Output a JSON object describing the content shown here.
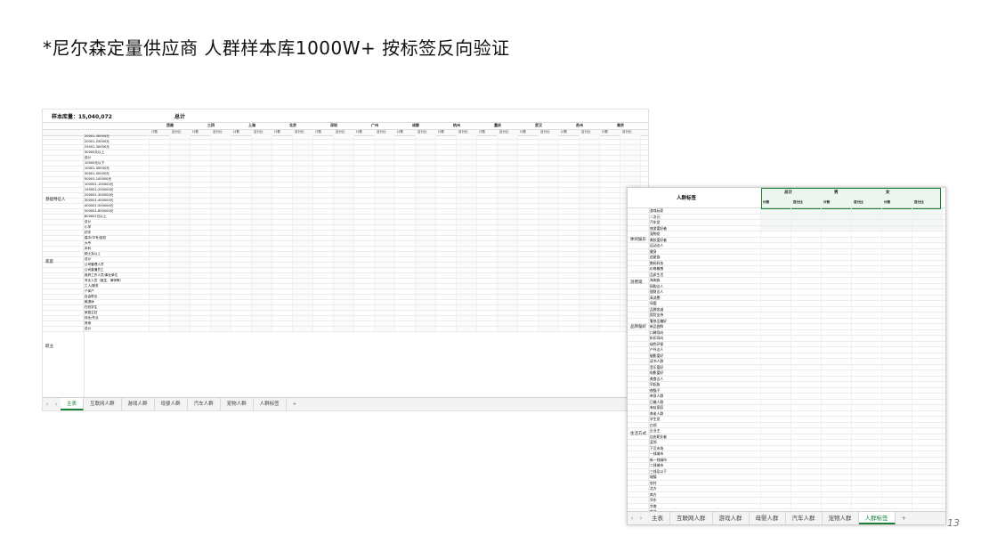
{
  "title": "*尼尔森定量供应商 人群样本库1000W+ 按标签反向验证",
  "page_number": "13",
  "sheet_left": {
    "sample_label": "样本库量：15,040,072",
    "total_label": "总计",
    "cities": [
      "西南",
      "三四",
      "上海",
      "北京",
      "深圳",
      "广州",
      "成都",
      "杭州",
      "重庆",
      "武汉",
      "苏州",
      "南京"
    ],
    "sub_headers": [
      "计数",
      "百分比"
    ],
    "categories": [
      "基础特征人",
      "家庭",
      "职业"
    ],
    "rows": [
      "20001-30000元",
      "20001-25000元",
      "25001-30000元",
      "30000元以上",
      "总计",
      "10000元以下",
      "10001-30000元",
      "30001-50000元",
      "50001-100000元",
      "100001-150000元",
      "150001-200000元",
      "200001-300000元",
      "300001-400000元",
      "400001-500000元",
      "500001-800000元",
      "800001元以上",
      "总计",
      "小学",
      "初中",
      "高中/中专/技校",
      "大专",
      "本科",
      "硕士及以上",
      "总计",
      "公司管理人员",
      "公司普通员工",
      "政府工作人员/事业单位",
      "专业人员（医生、律师等）",
      "工人/服务",
      "个体户",
      "自由职业",
      "离退休",
      "在校学生",
      "家庭主妇",
      "待业/失业",
      "其他",
      "总计"
    ],
    "tabs": [
      "主表",
      "互联网人群",
      "游戏人群",
      "母婴人群",
      "汽车人群",
      "宠物人群",
      "人群标签"
    ],
    "active_tab": "主表",
    "plus": "+"
  },
  "sheet_right": {
    "header_label": "人群标签",
    "col_groups": [
      "总计",
      "男",
      "女"
    ],
    "sub_headers": [
      "计数",
      "百分比",
      "计数",
      "百分比",
      "计数",
      "百分比"
    ],
    "categories": [
      "休闲娱乐",
      "消费观",
      "品牌偏好",
      "生活方式"
    ],
    "rows": [
      "游戏玩家",
      "二次元",
      "汽车党",
      "旅游爱好者",
      "宠物党",
      "美妆爱好者",
      "运动达人",
      "健身",
      "追星族",
      "数码科技",
      "价格敏感",
      "品质生活",
      "海淘族",
      "网购达人",
      "理财达人",
      "高消费",
      "母婴",
      "品牌忠诚",
      "国货支持",
      "奢侈品偏好",
      "新品尝鲜",
      "口碑导向",
      "折扣导向",
      "绿色环保",
      "户外达人",
      "摄影爱好",
      "读书人群",
      "音乐爱好",
      "电影爱好",
      "美食达人",
      "早起族",
      "夜猫子",
      "单身人群",
      "已婚人群",
      "有娃家庭",
      "养老人群",
      "学生党",
      "白领",
      "企业主",
      "自由职业者",
      "蓝领",
      "下沉市场",
      "一线城市",
      "新一线城市",
      "二线城市",
      "三线及以下",
      "城镇",
      "农村",
      "北方",
      "南方",
      "华东",
      "华南",
      "华北",
      "西南",
      "西北",
      "东北",
      "华中",
      "海外",
      "其他人群"
    ],
    "tabs": [
      "主表",
      "互联网人群",
      "游戏人群",
      "母婴人群",
      "汽车人群",
      "宠物人群",
      "人群标签"
    ],
    "active_tab": "人群标签",
    "plus": "+"
  }
}
